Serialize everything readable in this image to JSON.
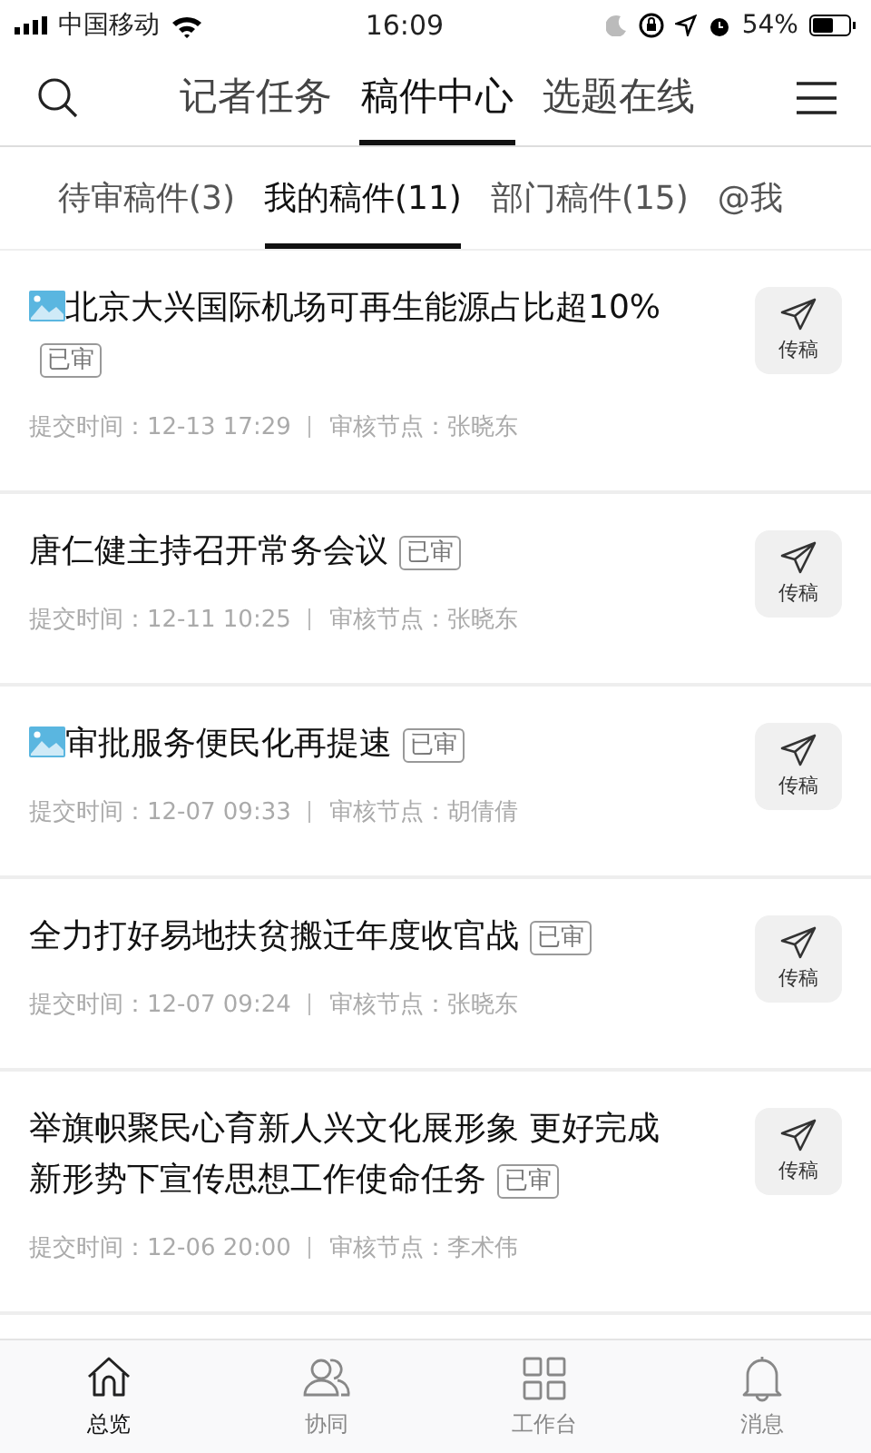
{
  "status_bar": {
    "carrier": "中国移动",
    "time": "16:09",
    "battery": "54%"
  },
  "header": {
    "tabs": [
      {
        "label": "记者任务",
        "selected": false
      },
      {
        "label": "稿件中心",
        "selected": true
      },
      {
        "label": "选题在线",
        "selected": false
      }
    ]
  },
  "sub_tabs": [
    {
      "label": "待审稿件(3)",
      "selected": false
    },
    {
      "label": "我的稿件(11)",
      "selected": true
    },
    {
      "label": "部门稿件(15)",
      "selected": false
    },
    {
      "label": "@我",
      "selected": false
    }
  ],
  "articles": [
    {
      "title_lines": [
        "北京大兴国际机场可再生能源占比超10%"
      ],
      "has_image": true,
      "badge": "已审",
      "submitted": "提交时间：12-13 17:29",
      "node": "审核节点：张晓东",
      "action": "传稿"
    },
    {
      "title_lines": [
        "唐仁健主持召开常务会议"
      ],
      "has_image": false,
      "badge": "已审",
      "submitted": "提交时间：12-11 10:25",
      "node": "审核节点：张晓东",
      "action": "传稿"
    },
    {
      "title_lines": [
        "审批服务便民化再提速"
      ],
      "has_image": true,
      "badge": "已审",
      "submitted": "提交时间：12-07 09:33",
      "node": "审核节点：胡倩倩",
      "action": "传稿"
    },
    {
      "title_lines": [
        "全力打好易地扶贫搬迁年度收官战"
      ],
      "has_image": false,
      "badge": "已审",
      "submitted": "提交时间：12-07 09:24",
      "node": "审核节点：张晓东",
      "action": "传稿"
    },
    {
      "title_lines": [
        "举旗帜聚民心育新人兴文化展形象 更好完成",
        "新形势下宣传思想工作使命任务"
      ],
      "has_image": false,
      "badge": "已审",
      "submitted": "提交时间：12-06 20:00",
      "node": "审核节点：李术伟",
      "action": "传稿"
    }
  ],
  "tab_bar": [
    {
      "kind": "home",
      "label": "总览",
      "selected": true
    },
    {
      "kind": "people",
      "label": "协同",
      "selected": false
    },
    {
      "kind": "grid",
      "label": "工作台",
      "selected": false
    },
    {
      "kind": "bell",
      "label": "消息",
      "selected": false
    }
  ]
}
